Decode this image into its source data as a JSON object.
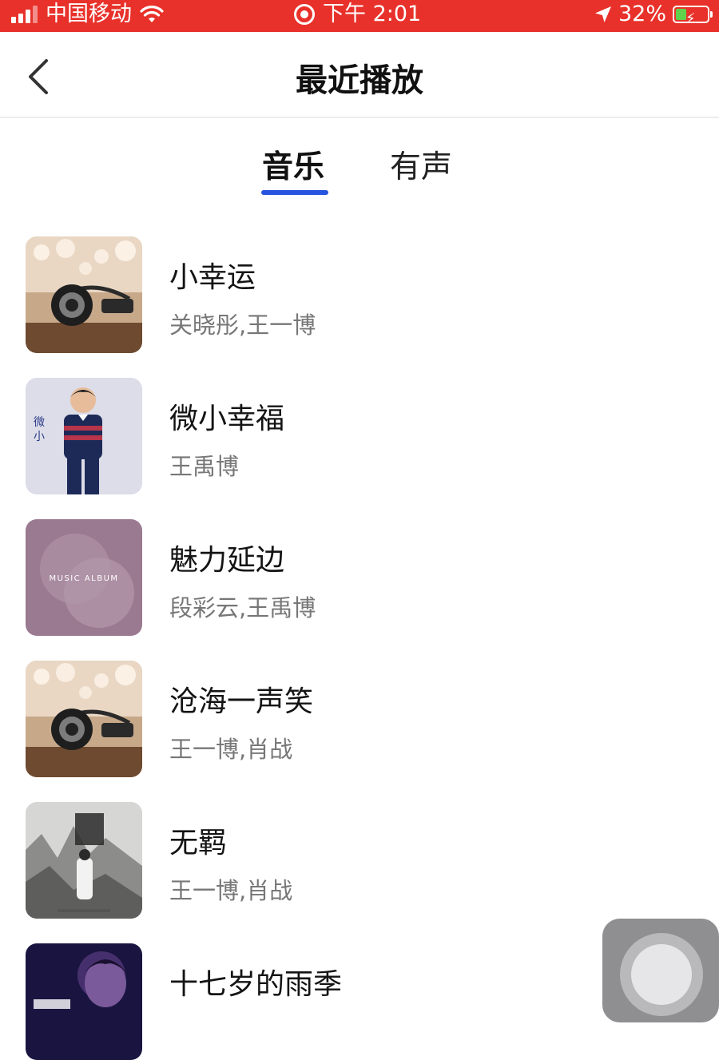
{
  "status_bar": {
    "carrier": "中国移动",
    "time": "下午 2:01",
    "battery": "32%",
    "battery_level": 0.32,
    "icons": [
      "signal-icon",
      "wifi-icon",
      "screen-recording-icon",
      "location-arrow-icon",
      "battery-charging-icon"
    ]
  },
  "nav": {
    "back_icon": "chevron-left-icon",
    "title": "最近播放"
  },
  "tabs": [
    {
      "label": "音乐",
      "active": true
    },
    {
      "label": "有声",
      "active": false
    }
  ],
  "accent_color": "#2653e0",
  "status_bar_color": "#e8312a",
  "songs": [
    {
      "title": "小幸运",
      "artist": "关晓彤,王一博",
      "cover": "headphones-cover"
    },
    {
      "title": "微小幸福",
      "artist": "王禹博",
      "cover": "boy-portrait-cover"
    },
    {
      "title": "魅力延边",
      "artist": "段彩云,王禹博",
      "cover": "music-album-cover",
      "cover_text": "MUSIC ALBUM"
    },
    {
      "title": "沧海一声笑",
      "artist": "王一博,肖战",
      "cover": "headphones-cover"
    },
    {
      "title": "无羁",
      "artist": "王一博,肖战",
      "cover": "ink-painting-cover"
    },
    {
      "title": "十七岁的雨季",
      "artist": "",
      "cover": "portrait-purple-cover"
    }
  ]
}
